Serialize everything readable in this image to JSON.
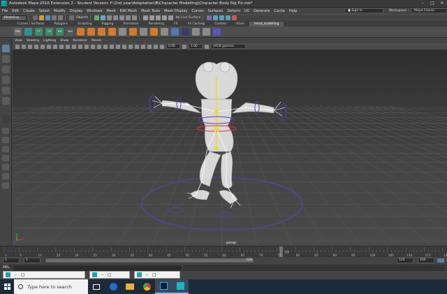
{
  "window": {
    "title": "Autodesk Maya 2016 Extension 2 - Student Version: F:\\2nd year\\Adaptation\\B\\Character Modelling\\Character Body Rig Fin.mb*",
    "minimize": "–",
    "maximize": "□",
    "close": "✕"
  },
  "menubar": {
    "items": [
      "File",
      "Edit",
      "Create",
      "Select",
      "Modify",
      "Display",
      "Windows",
      "Mesh",
      "Edit Mesh",
      "Mesh Tools",
      "Mesh Display",
      "Curves",
      "Surfaces",
      "Deform",
      "UV",
      "Generate",
      "Cache",
      "Help"
    ],
    "workspace_label": "Workspace :",
    "workspace_value": "Maya Classic",
    "signin": "Sign In"
  },
  "statusline": {
    "menuset": "Modeling",
    "objects_label": "Objects",
    "live_surface": "No Live Surface"
  },
  "shelf": {
    "tabs": [
      "Curves / Surfaces",
      "Polygons",
      "Sculpting",
      "Rigging",
      "Animation",
      "Rendering",
      "FX",
      "FX Caching",
      "Custom",
      "XGen",
      "Head_modelling"
    ],
    "active_tab": "Head_modelling",
    "icon_labels": [
      "FBX",
      "FT",
      "CP",
      "FN",
      "Sell"
    ]
  },
  "panel": {
    "menu": [
      "View",
      "Shading",
      "Lighting",
      "Show",
      "Renderer",
      "Panels"
    ],
    "field_a": "0.00",
    "field_b": "1.00",
    "color_space": "sRGB gamma",
    "camera_label": "persp"
  },
  "timeline": {
    "ticks": [
      "1",
      "5",
      "10",
      "15",
      "20",
      "25",
      "30",
      "35",
      "40",
      "45",
      "50",
      "55",
      "60",
      "65",
      "70",
      "75",
      "80",
      "85",
      "90",
      "95",
      "100",
      "105",
      "110",
      "115",
      "120"
    ],
    "current_frame": "77",
    "range_start": "1",
    "range_inner_start": "1",
    "range_inner_end": "120",
    "range_end": "120",
    "anim_end": "200",
    "current_frame_field": "120"
  },
  "commandline": {
    "lang": "MEL"
  },
  "taskbar": {
    "search_placeholder": "Type here to search",
    "apps": [
      "task-view",
      "edge",
      "file-explorer",
      "chrome",
      "photoshop",
      "maya"
    ]
  },
  "colors": {
    "accent": "#5d7f9e",
    "joint_yellow": "#e8e020",
    "controls_purple": "#5a3fa8",
    "skeleton_white": "#ffffff"
  }
}
